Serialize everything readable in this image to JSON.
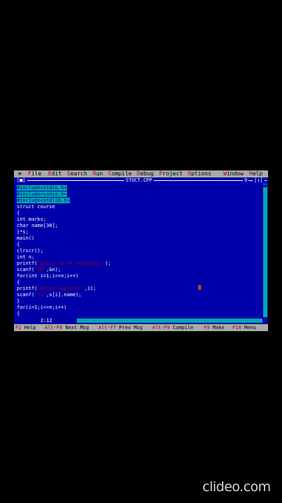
{
  "menu": {
    "system": "≡",
    "items": [
      {
        "hot": "F",
        "rest": "ile"
      },
      {
        "hot": "E",
        "rest": "dit"
      },
      {
        "hot": "S",
        "rest": "earch"
      },
      {
        "hot": "R",
        "rest": "un"
      },
      {
        "hot": "C",
        "rest": "ompile"
      },
      {
        "hot": "D",
        "rest": "ebug"
      },
      {
        "hot": "P",
        "rest": "roject"
      },
      {
        "hot": "O",
        "rest": "ptions"
      },
      {
        "hot": "W",
        "rest": "indow"
      },
      {
        "hot": "H",
        "rest": "elp"
      }
    ]
  },
  "window": {
    "close_box": "[■]",
    "title": "STUCT.CPP",
    "number": "9",
    "zoom_box": "[↕]"
  },
  "code": [
    [
      {
        "t": "#include<stdio.h>",
        "c": "pp"
      }
    ],
    [
      {
        "t": "#include<conio.h>",
        "c": "pp"
      }
    ],
    [
      {
        "t": "#include<stdlib.h>",
        "c": "pp"
      }
    ],
    [
      {
        "t": "struct course"
      }
    ],
    [
      {
        "t": "{"
      }
    ],
    [
      {
        "t": "int marks;"
      }
    ],
    [
      {
        "t": "char name[30];"
      }
    ],
    [
      {
        "t": "}*s;"
      }
    ],
    [
      {
        "t": "main()"
      }
    ],
    [
      {
        "t": "{"
      }
    ],
    [
      {
        "t": "clrscr();"
      }
    ],
    [
      {
        "t": "int n;"
      }
    ],
    [
      {
        "t": "printf("
      },
      {
        "t": "\"Enter no of subjects:\"",
        "c": "str"
      },
      {
        "t": ");"
      }
    ],
    [
      {
        "t": "scanf("
      },
      {
        "t": "\"%d\"",
        "c": "str"
      },
      {
        "t": ",&n);"
      }
    ],
    [
      {
        "t": "for(int i=1;i<=n;i++)"
      }
    ],
    [
      {
        "t": "{"
      }
    ],
    [
      {
        "t": "printf("
      },
      {
        "t": "\"Enter subject:\"",
        "c": "str"
      },
      {
        "t": ",i);"
      }
    ],
    [
      {
        "t": "scanf("
      },
      {
        "t": "\"%s\"",
        "c": "str"
      },
      {
        "t": ",s[i].name);"
      }
    ],
    [
      {
        "t": "}"
      }
    ],
    [
      {
        "t": "for(i=1;i<=n;i++)"
      }
    ],
    [
      {
        "t": "{"
      }
    ]
  ],
  "status": {
    "position": "2:12"
  },
  "fnbar": [
    {
      "key": "F1",
      "label": "Help"
    },
    {
      "key": "Alt-F8",
      "label": "Next Msg"
    },
    {
      "key": "Alt-F7",
      "label": "Prev Msg"
    },
    {
      "key": "Alt-F9",
      "label": "Compile"
    },
    {
      "key": "F9",
      "label": "Make"
    },
    {
      "key": "F10",
      "label": "Menu"
    }
  ],
  "watermark": "clideo.com",
  "colors": {
    "editor_bg": "#0000AA",
    "menu_bg": "#AAAAAA",
    "hotkey": "#AA0000",
    "preprocessor_bg": "#00AAAA",
    "string": "#AA0000",
    "cursor": "#AA5500"
  }
}
